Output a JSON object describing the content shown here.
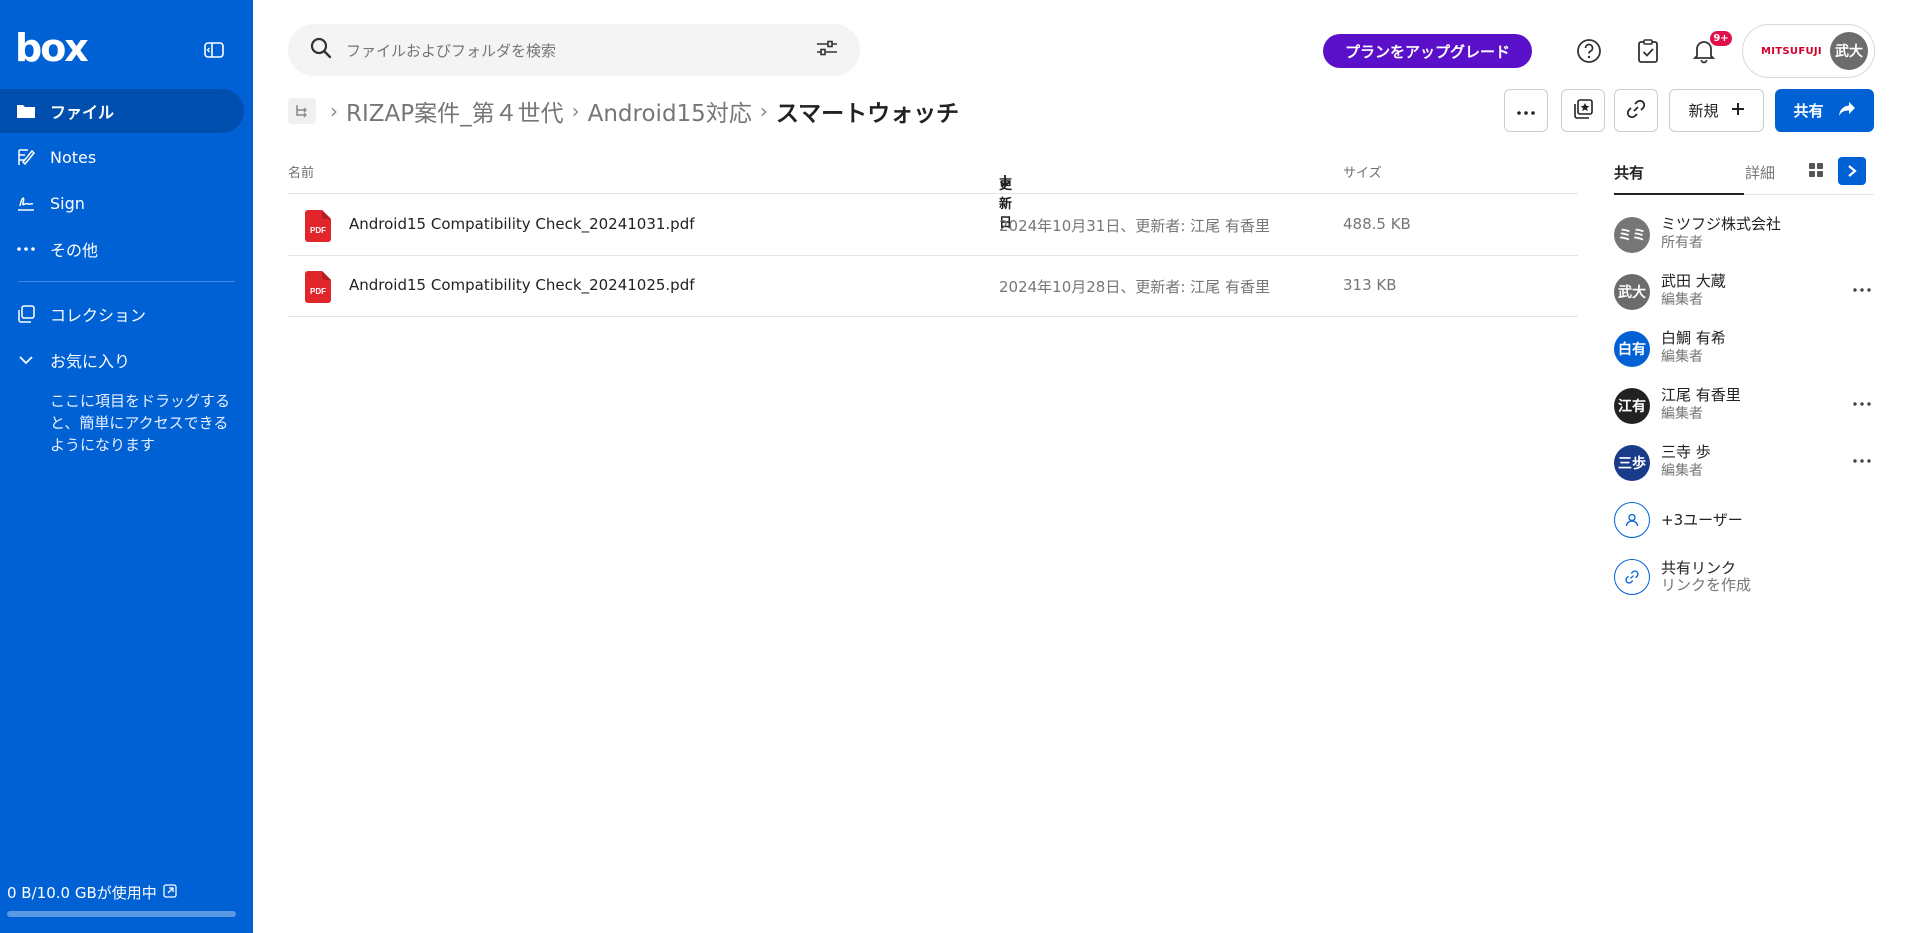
{
  "sidebar": {
    "logo": "box",
    "items": [
      {
        "label": "ファイル",
        "icon": "folder-icon",
        "active": true
      },
      {
        "label": "Notes",
        "icon": "notes-icon"
      },
      {
        "label": "Sign",
        "icon": "sign-icon"
      },
      {
        "label": "その他",
        "icon": "more-horizontal-icon"
      }
    ],
    "collections_label": "コレクション",
    "favorites_label": "お気に入り",
    "favorites_hint": "ここに項目をドラッグすると、簡単にアクセスできるようになります",
    "storage_text": "0 B/10.0 GBが使用中",
    "storage_used_fraction": 0
  },
  "header": {
    "search_placeholder": "ファイルおよびフォルダを検索",
    "upgrade_label": "プランをアップグレード",
    "notification_badge": "9+",
    "account_brand": "MITSUFUJI",
    "account_initials": "武大"
  },
  "breadcrumb": {
    "items": [
      "RIZAP案件_第４世代",
      "Android15対応"
    ],
    "current": "スマートウォッチ"
  },
  "toolbar": {
    "new_label": "新規",
    "share_label": "共有"
  },
  "table": {
    "columns": {
      "name": "名前",
      "updated": "更新日",
      "size": "サイズ"
    },
    "rows": [
      {
        "name": "Android15 Compatibility Check_20241031.pdf",
        "updated": "2024年10月31日、更新者: 江尾 有香里",
        "size": "488.5 KB"
      },
      {
        "name": "Android15 Compatibility Check_20241025.pdf",
        "updated": "2024年10月28日、更新者: 江尾 有香里",
        "size": "313 KB"
      }
    ]
  },
  "panel": {
    "tabs": [
      "共有",
      "詳細"
    ],
    "collaborators": [
      {
        "initials": "ミミ",
        "name": "ミツフジ株式会社",
        "role": "所有者",
        "color": "#767676",
        "more": false
      },
      {
        "initials": "武大",
        "name": "武田 大蔵",
        "role": "編集者",
        "color": "#6c6c6c",
        "more": true
      },
      {
        "initials": "白有",
        "name": "白鯛 有希",
        "role": "編集者",
        "color": "#0061d5",
        "more": false
      },
      {
        "initials": "江有",
        "name": "江尾 有香里",
        "role": "編集者",
        "color": "#222222",
        "more": true
      },
      {
        "initials": "三歩",
        "name": "三寺 歩",
        "role": "編集者",
        "color": "#1a3a8a",
        "more": true
      }
    ],
    "more_users": "+3ユーザー",
    "shared_link_title": "共有リンク",
    "shared_link_action": "リンクを作成"
  },
  "colors": {
    "sidebar": "#0061d5",
    "upgrade": "#5a10c8",
    "primary": "#0061d5",
    "badge": "#e0114a"
  }
}
